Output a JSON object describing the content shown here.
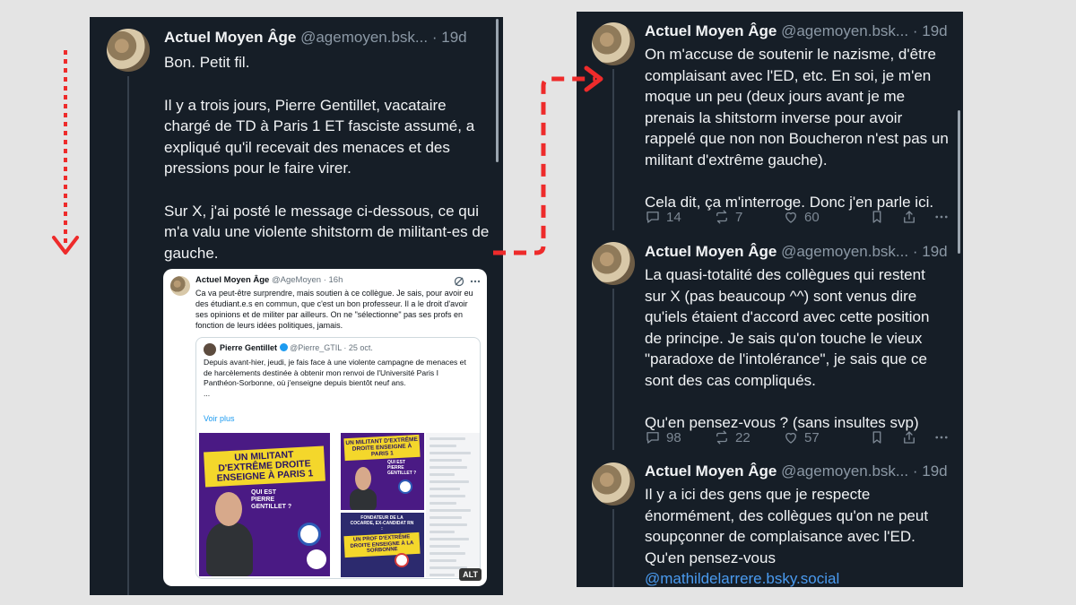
{
  "colors": {
    "panel_bg": "#161e27",
    "arrow": "#ee2b2b",
    "link": "#4a9bf0",
    "muted": "#8b98a5"
  },
  "left_post": {
    "name": "Actuel Moyen Âge",
    "handle": "@agemoyen.bsk...",
    "sep": "·",
    "time": "19d",
    "paragraphs": [
      "Bon. Petit fil.",
      "Il y a trois jours, Pierre Gentillet, vacataire chargé de TD à Paris 1 ET fasciste assumé, a expliqué qu'il recevait des menaces et des pressions pour le faire virer.",
      "Sur X, j'ai posté le message ci-dessous, ce qui m'a valu une violente shitstorm de militant-es de gauche."
    ],
    "embed": {
      "name": "Actuel Moyen Âge",
      "handle": "@AgeMoyen · 16h",
      "text": "Ca va peut-être surprendre, mais soutien à ce collègue. Je sais, pour avoir eu des étudiant.e.s en commun, que c'est un bon professeur. Il a le droit d'avoir ses opinions et de militer par ailleurs. On ne \"sélectionne\" pas ses profs en fonction de leurs idées politiques, jamais.",
      "quote": {
        "name": "Pierre Gentillet",
        "handle": "@Pierre_GTIL · 25 oct.",
        "text": "Depuis avant-hier, jeudi, je fais face à une violente campagne de menaces et de harcèlements destinée à obtenir mon renvoi de l'Université Paris I Panthéon-Sorbonne, où j'enseigne depuis bientôt neuf ans.",
        "ellipsis": "...",
        "more": "Voir plus"
      },
      "image_big": {
        "banner": "UN MILITANT D'EXTRÊME DROITE ENSEIGNE À PARIS 1",
        "sub": "QUI EST PIERRE GENTILLET ?"
      },
      "image_tr": {
        "banner": "UN MILITANT D'EXTRÊME DROITE ENSEIGNE À PARIS 1",
        "sub": "QUI EST PIERRE GENTILLET ?"
      },
      "image_br": {
        "top": "FONDATEUR DE LA COCARDE, EX-CANDIDAT RN :",
        "banner": "UN PROF D'EXTRÊME DROITE ENSEIGNE À LA SORBONNE"
      },
      "alt": "ALT"
    }
  },
  "right_posts": [
    {
      "name": "Actuel Moyen Âge",
      "handle": "@agemoyen.bsk...",
      "sep": "·",
      "time": "19d",
      "paragraphs": [
        "On m'accuse de soutenir le nazisme, d'être complaisant avec l'ED, etc. En soi, je m'en moque un peu (deux jours avant je me prenais la shitstorm inverse pour avoir rappelé que non non Boucheron n'est pas un militant d'extrême gauche).",
        "Cela dit, ça m'interroge. Donc j'en parle ici."
      ],
      "replies": "14",
      "reposts": "7",
      "likes": "60"
    },
    {
      "name": "Actuel Moyen Âge",
      "handle": "@agemoyen.bsk...",
      "sep": "·",
      "time": "19d",
      "paragraphs": [
        "La quasi-totalité des collègues qui restent sur X (pas beaucoup ^^) sont venus dire qu'iels étaient d'accord avec cette position de principe. Je sais qu'on touche le vieux \"paradoxe de l'intolérance\", je sais que ce sont des cas compliqués.",
        "Qu'en pensez-vous ? (sans insultes svp)"
      ],
      "replies": "98",
      "reposts": "22",
      "likes": "57"
    },
    {
      "name": "Actuel Moyen Âge",
      "handle": "@agemoyen.bsk...",
      "sep": "·",
      "time": "19d",
      "text": "Il y a ici des gens que je respecte énormément, des collègues qu'on ne peut soupçonner de complaisance avec l'ED. Qu'en pensez-vous",
      "mention": "@mathildelarrere.bsky.social"
    }
  ]
}
